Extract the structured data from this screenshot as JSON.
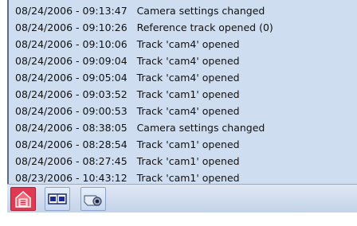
{
  "log": {
    "entries": [
      {
        "timestamp": "08/24/2006 - 09:13:47",
        "message": "Camera settings changed"
      },
      {
        "timestamp": "08/24/2006 - 09:10:26",
        "message": "Reference track opened (0)"
      },
      {
        "timestamp": "08/24/2006 - 09:10:06",
        "message": "Track 'cam4' opened"
      },
      {
        "timestamp": "08/24/2006 - 09:09:04",
        "message": "Track 'cam4' opened"
      },
      {
        "timestamp": "08/24/2006 - 09:05:04",
        "message": "Track 'cam4' opened"
      },
      {
        "timestamp": "08/24/2006 - 09:03:52",
        "message": "Track 'cam1' opened"
      },
      {
        "timestamp": "08/24/2006 - 09:00:53",
        "message": "Track 'cam4' opened"
      },
      {
        "timestamp": "08/24/2006 - 08:38:05",
        "message": "Camera settings changed"
      },
      {
        "timestamp": "08/24/2006 - 08:28:54",
        "message": "Track 'cam1' opened"
      },
      {
        "timestamp": "08/24/2006 - 08:27:45",
        "message": "Track 'cam1' opened"
      },
      {
        "timestamp": "08/23/2006 - 10:43:12",
        "message": "Track 'cam1' opened"
      }
    ]
  },
  "toolbar": {
    "buttons": [
      {
        "icon": "track-manager-icon",
        "active": true
      },
      {
        "icon": "split-view-icon",
        "active": false
      },
      {
        "icon": "camera-icon",
        "active": false
      }
    ]
  },
  "colors": {
    "panel_background": "#cfddf0",
    "active_button": "#e03a52",
    "text": "#111111"
  }
}
